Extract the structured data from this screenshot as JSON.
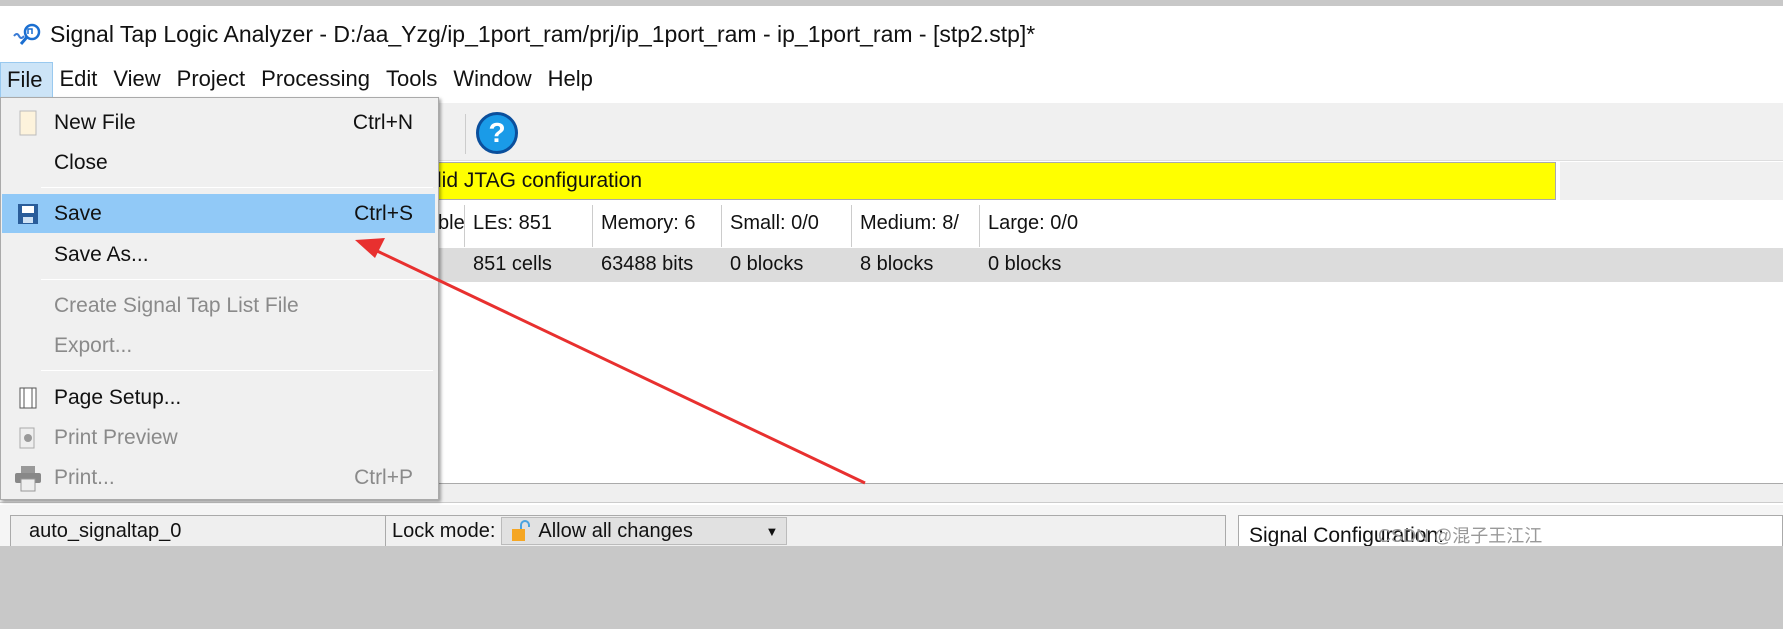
{
  "window": {
    "title": "Signal Tap Logic Analyzer - D:/aa_Yzg/ip_1port_ram/prj/ip_1port_ram - ip_1port_ram - [stp2.stp]*"
  },
  "menubar": [
    "File",
    "Edit",
    "View",
    "Project",
    "Processing",
    "Tools",
    "Window",
    "Help"
  ],
  "file_menu": {
    "items": [
      {
        "label": "New File",
        "shortcut": "Ctrl+N",
        "icon": "new-file-icon",
        "enabled": true
      },
      {
        "label": "Close",
        "shortcut": "",
        "enabled": true
      },
      {
        "label": "Save",
        "shortcut": "Ctrl+S",
        "icon": "save-icon",
        "enabled": true,
        "highlighted": true
      },
      {
        "label": "Save As...",
        "shortcut": "",
        "enabled": true
      },
      {
        "label": "Create Signal Tap List File",
        "shortcut": "",
        "enabled": false
      },
      {
        "label": "Export...",
        "shortcut": "",
        "enabled": false
      },
      {
        "label": "Page Setup...",
        "shortcut": "",
        "icon": "page-setup-icon",
        "enabled": true
      },
      {
        "label": "Print Preview",
        "shortcut": "",
        "icon": "print-preview-icon",
        "enabled": false
      },
      {
        "label": "Print...",
        "shortcut": "Ctrl+P",
        "icon": "printer-icon",
        "enabled": false
      }
    ]
  },
  "toolbar": {
    "help_label": "?"
  },
  "status_banner": "lid JTAG configuration",
  "stats": {
    "headers": [
      "ble",
      "LEs: 851",
      "Memory: 6",
      "Small: 0/0",
      "Medium: 8/",
      "Large: 0/0"
    ],
    "values": [
      "",
      "851 cells",
      "63488 bits",
      "0 blocks",
      "8 blocks",
      "0 blocks"
    ]
  },
  "bottom": {
    "instance": "auto_signaltap_0",
    "lock_label": "Lock mode:",
    "lock_value": "Allow all changes",
    "signal_config": "Signal Configuration:",
    "watermark": "CSDN @混子王江江"
  },
  "colors": {
    "banner": "#ffff00",
    "highlight": "#91c9f7",
    "arrow": "#e8302f"
  }
}
